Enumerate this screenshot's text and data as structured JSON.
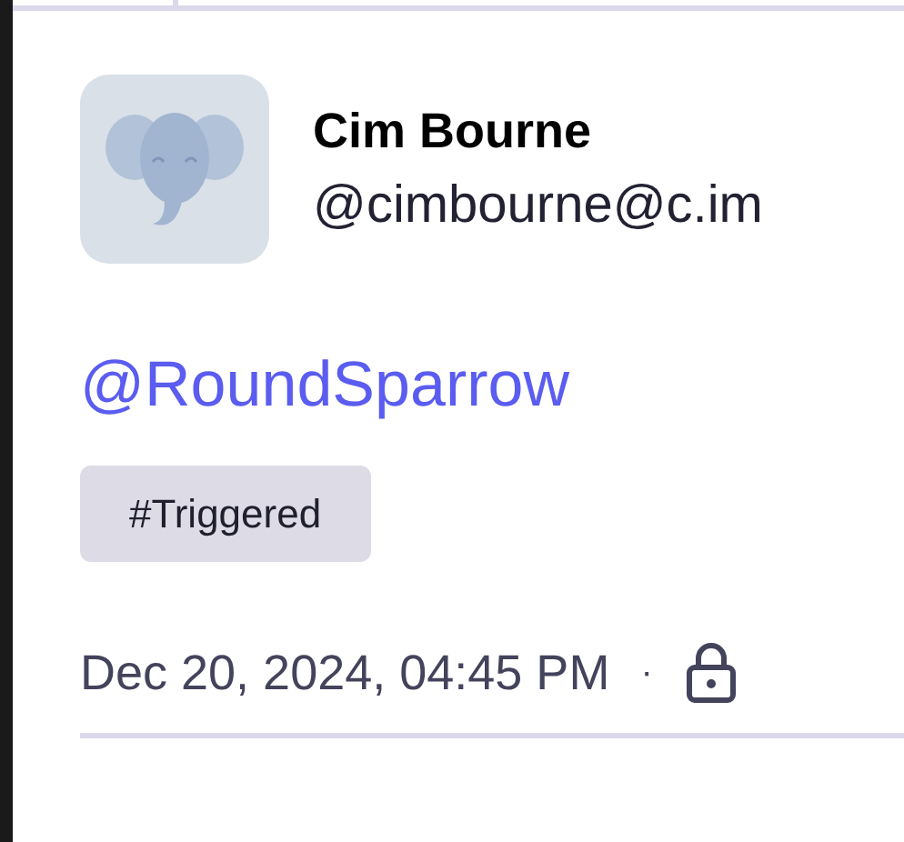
{
  "author": {
    "name": "Cim Bourne",
    "handle": "@cimbourne@c.im"
  },
  "mention": "@RoundSparrow",
  "tags": [
    "#Triggered"
  ],
  "meta": {
    "timestamp": "Dec 20, 2024, 04:45 PM",
    "separator": "·",
    "locked": true
  }
}
